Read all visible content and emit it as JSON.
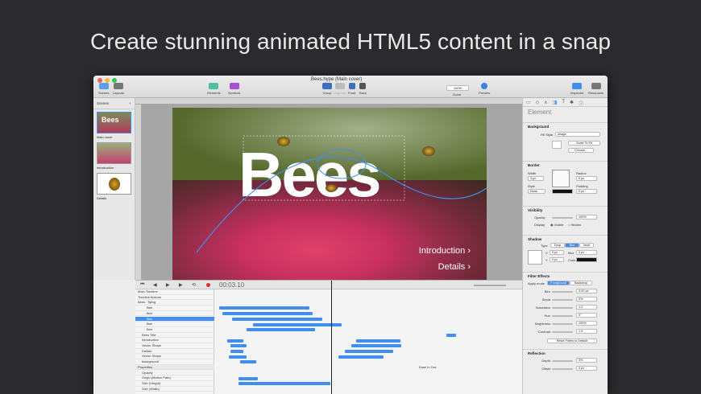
{
  "headline": "Create stunning animated HTML5 content in a snap",
  "window": {
    "title": "Bees.hype (Main cover)",
    "lights": [
      "#fc5f57",
      "#fdbc2e",
      "#34c84a"
    ]
  },
  "toolbar": {
    "scenes": "Scenes",
    "layouts": "Layouts",
    "elements": "Elements",
    "symbols": "Symbols",
    "group": "Group",
    "ungroup": "Ungroup",
    "front": "Front",
    "back": "Back",
    "zoom_label": "Zoom",
    "zoom_value": "100%",
    "preview": "Preview",
    "inspector": "Inspector",
    "resources": "Resources"
  },
  "scenes_panel": {
    "header": "Scenes",
    "add": "+",
    "items": [
      {
        "label": "Main cover",
        "thumb": "Bees"
      },
      {
        "label": "Introduction",
        "thumb": ""
      },
      {
        "label": "Details",
        "thumb": ""
      }
    ]
  },
  "stage": {
    "title": "Bees",
    "links": [
      "Introduction ›",
      "Details ›"
    ]
  },
  "inspector": {
    "tab_title": "Element",
    "background": {
      "title": "Background",
      "fill_label": "Fill Style",
      "fill_value": "Image",
      "scale_value": "Scale To Fit",
      "choose": "Choose..."
    },
    "border": {
      "title": "Border",
      "width_label": "Width",
      "width_value": "0 px",
      "style_label": "Style",
      "style_value": "None",
      "radius_label": "Radius",
      "radius_value": "0 px",
      "padding_label": "Padding",
      "padding_value": "0 px"
    },
    "visibility": {
      "title": "Visibility",
      "opacity_label": "Opacity",
      "opacity_value": "100%",
      "display_label": "Display",
      "visible": "Visible",
      "hidden": "Hidden"
    },
    "shadow": {
      "title": "Shadow",
      "type_label": "Type",
      "types": [
        "Drop",
        "Box",
        "Inset"
      ],
      "x_label": "X",
      "x_value": "0 px",
      "y_label": "Y",
      "y_value": "0 px",
      "blur_label": "Blur",
      "blur_value": "0 px",
      "color_label": "Color"
    },
    "filters": {
      "title": "Filter Effects",
      "apply_label": "Apply mode",
      "modes": [
        "Foreground",
        "Backdrop"
      ],
      "items": [
        {
          "label": "Blur",
          "value": "0.00 px"
        },
        {
          "label": "Sepia",
          "value": "0%"
        },
        {
          "label": "Saturation",
          "value": "1.0"
        },
        {
          "label": "Hue",
          "value": "0°"
        },
        {
          "label": "Brightness",
          "value": "100%"
        },
        {
          "label": "Contrast",
          "value": "1.0"
        }
      ],
      "reset": "Reset Filters to Default"
    },
    "reflection": {
      "title": "Reflection",
      "depth_label": "Depth",
      "depth_value": "0%",
      "offset_label": "Offset",
      "offset_value": "0 px"
    }
  },
  "timeline": {
    "time": "00:03.10",
    "rows": [
      "Main Timeline",
      "Timeline Actions",
      "Bees · flying",
      "Bee",
      "Bee",
      "Bee",
      "Bee",
      "Bee",
      "Bees Title",
      "Introduction",
      "Vector Shape",
      "Details",
      "Vector Shape",
      "background",
      "Properties",
      "Opacity",
      "Origin (Motion Path)",
      "Size (Height)",
      "Size (Width)"
    ],
    "ease": "Ease In Out"
  },
  "colors": {
    "accent": "#3f8ef0"
  }
}
